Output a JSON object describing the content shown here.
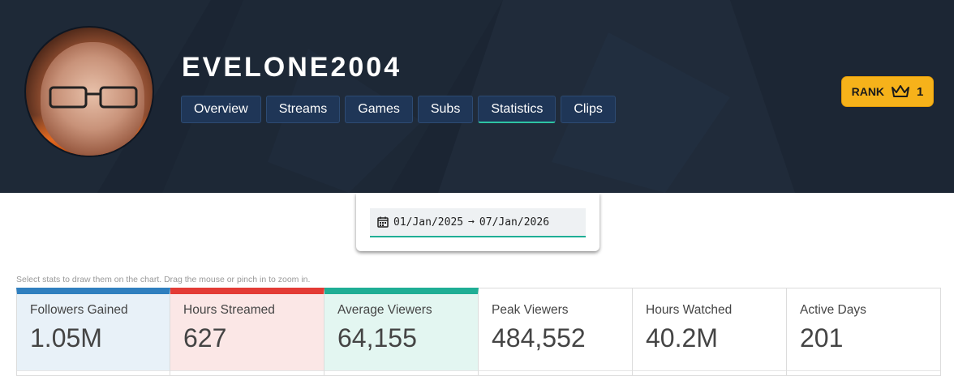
{
  "channel": {
    "name": "EVELONE2004"
  },
  "tabs": [
    {
      "label": "Overview"
    },
    {
      "label": "Streams"
    },
    {
      "label": "Games"
    },
    {
      "label": "Subs"
    },
    {
      "label": "Statistics"
    },
    {
      "label": "Clips"
    }
  ],
  "active_tab": "Statistics",
  "rank": {
    "label": "RANK",
    "value": "1",
    "icon": "crown-icon"
  },
  "date_range": {
    "start": "01/Jan/2025",
    "arrow": "➞",
    "end": "07/Jan/2026",
    "icon": "calendar-icon"
  },
  "hint": "Select stats to draw them on the chart. Drag the mouse or pinch in to zoom in.",
  "stats": [
    {
      "name": "Followers Gained",
      "value": "1.05M",
      "color": "#2f7fbf",
      "selected": true
    },
    {
      "name": "Hours Streamed",
      "value": "627",
      "color": "#e33b35",
      "selected": true
    },
    {
      "name": "Average Viewers",
      "value": "64,155",
      "color": "#1fae95",
      "selected": true
    },
    {
      "name": "Peak Viewers",
      "value": "484,552",
      "selected": false
    },
    {
      "name": "Hours Watched",
      "value": "40.2M",
      "selected": false
    },
    {
      "name": "Active Days",
      "value": "201",
      "selected": false
    }
  ],
  "colors": {
    "header_bg": "#1b2533",
    "tab_bg": "#1f3657",
    "accent": "#1fae95",
    "rank_bg": "#f6b21a"
  }
}
